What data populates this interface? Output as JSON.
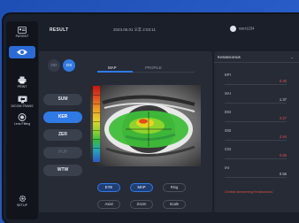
{
  "header": {
    "title": "RESULT",
    "datetime": "2023.06.01  오후 2:03:11",
    "user": "user1234"
  },
  "rail": {
    "items": [
      {
        "label": "PATIENT",
        "icon": "patient-card-icon"
      },
      {
        "label": "",
        "icon": "eye-icon"
      },
      {
        "label": "PRINT",
        "icon": "printer-icon"
      },
      {
        "label": "DICOM TRANS",
        "icon": "dicom-transfer-icon"
      },
      {
        "label": "Lens Fitting",
        "icon": "lens-fitting-icon"
      },
      {
        "label": "SETUP",
        "icon": "gear-icon"
      }
    ]
  },
  "eye_toggle": {
    "od": "OD",
    "os": "OS",
    "selected": "OS"
  },
  "modes": [
    {
      "label": "SUM",
      "state": "normal"
    },
    {
      "label": "KER",
      "state": "active"
    },
    {
      "label": "ZER",
      "state": "normal"
    },
    {
      "label": "PUP",
      "state": "disabled"
    },
    {
      "label": "WTW",
      "state": "normal"
    }
  ],
  "tabs": [
    {
      "label": "MAP",
      "active": true
    },
    {
      "label": "PROFILE",
      "active": false
    }
  ],
  "tools_row1": [
    {
      "label": "EYE",
      "on": true
    },
    {
      "label": "MAP",
      "on": true
    },
    {
      "label": "Ring",
      "on": false
    }
  ],
  "tools_row2": [
    {
      "label": "Axial",
      "on": false
    },
    {
      "label": "Zoom",
      "on": false
    },
    {
      "label": "Scale",
      "on": false
    }
  ],
  "side": {
    "dropdown": "Keratoconus",
    "metrics": [
      {
        "key": "KPI",
        "value": "0.35",
        "color": "#e0503f"
      },
      {
        "key": "SAI",
        "value": "1.37",
        "color": "#c9ced8"
      },
      {
        "key": "DSI",
        "value": "3.27",
        "color": "#e0503f"
      },
      {
        "key": "OSI",
        "value": "2.94",
        "color": "#e0503f"
      },
      {
        "key": "CSI",
        "value": "0.86",
        "color": "#e0503f"
      },
      {
        "key": "IAI",
        "value": "0.56",
        "color": "#c9ced8"
      }
    ],
    "note": "Central steepening Keratoconus"
  },
  "colors": {
    "accent": "#2f7ae5",
    "alert": "#e0503f",
    "panel": "#262b36"
  }
}
